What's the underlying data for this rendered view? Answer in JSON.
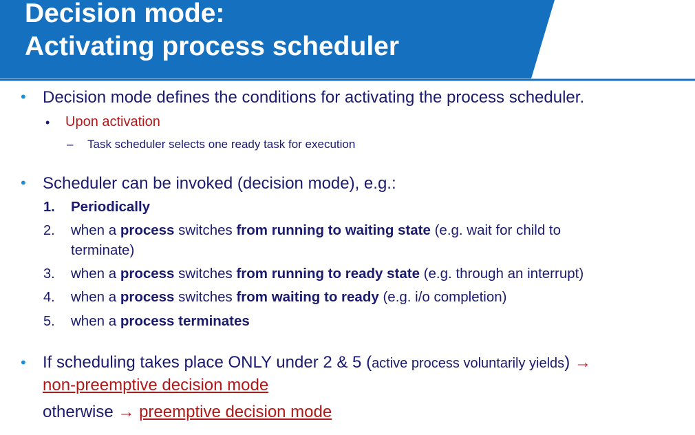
{
  "slide": {
    "title_line1": "Decision mode:",
    "title_line2": "Activating process scheduler",
    "colors": {
      "header_blue": "#1570c0",
      "bullet_blue": "#1f8fd6",
      "text_navy": "#1a1a6e",
      "accent_red": "#b01818"
    },
    "bullet1": {
      "text": "Decision mode defines the conditions for activating the process scheduler.",
      "sub": "Upon activation",
      "subsub": "Task scheduler selects one ready task for execution"
    },
    "bullet2": {
      "text": "Scheduler can be invoked (decision mode), e.g.:",
      "items": [
        {
          "num": "1.",
          "parts": [
            "Periodically"
          ]
        },
        {
          "num": "2.",
          "parts": [
            "when a ",
            "process",
            " switches ",
            "from running to waiting state",
            " (e.g. wait for child to",
            "terminate)"
          ]
        },
        {
          "num": "3.",
          "parts": [
            "when a ",
            "process",
            " switches ",
            "from running to ready state",
            " (e.g. through an interrupt)"
          ]
        },
        {
          "num": "4.",
          "parts": [
            "when a ",
            "process",
            " switches ",
            "from waiting to ready",
            " (e.g. i/o completion)"
          ]
        },
        {
          "num": "5.",
          "parts": [
            "when a ",
            "process terminates"
          ]
        }
      ]
    },
    "bullet3": {
      "text_a": "If scheduling takes place ONLY under 2 & 5 (",
      "text_b": "active process voluntarily yields",
      "text_c": ")",
      "arrow": "→",
      "link1": "non-preemptive decision mode",
      "otherwise": "otherwise",
      "link2": "preemptive decision mode"
    }
  }
}
